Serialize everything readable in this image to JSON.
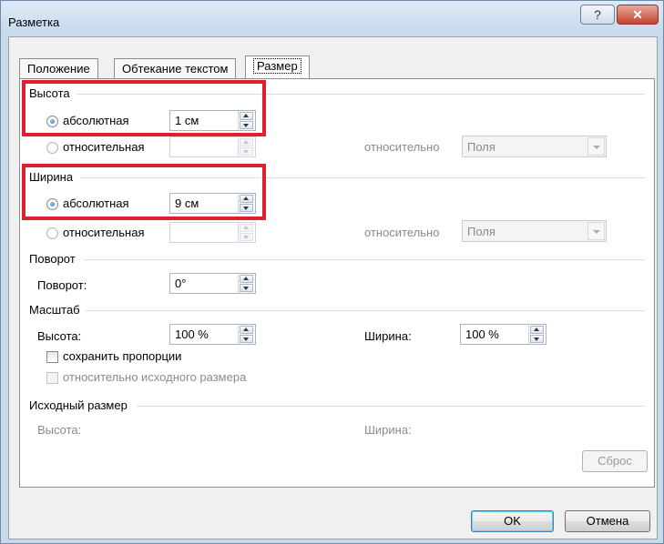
{
  "window": {
    "title": "Разметка",
    "help_label": "?",
    "close_label": "✕"
  },
  "tabs": [
    {
      "label": "Положение"
    },
    {
      "label": "Обтекание текстом"
    },
    {
      "label": "Размер"
    }
  ],
  "height_group": {
    "title": "Высота",
    "absolute_label": "абсолютная",
    "absolute_value": "1 см",
    "relative_label": "относительная",
    "relative_to_label": "относительно",
    "relative_to_value": "Поля"
  },
  "width_group": {
    "title": "Ширина",
    "absolute_label": "абсолютная",
    "absolute_value": "9 см",
    "relative_label": "относительная",
    "relative_to_label": "относительно",
    "relative_to_value": "Поля"
  },
  "rotation_group": {
    "title": "Поворот",
    "rotation_label": "Поворот:",
    "rotation_value": "0°"
  },
  "scale_group": {
    "title": "Масштаб",
    "height_label": "Высота:",
    "height_value": "100 %",
    "width_label": "Ширина:",
    "width_value": "100 %",
    "lock_aspect_label": "сохранить пропорции",
    "relative_original_label": "относительно исходного размера"
  },
  "original_group": {
    "title": "Исходный размер",
    "height_label": "Высота:",
    "width_label": "Ширина:"
  },
  "buttons": {
    "reset": "Сброс",
    "ok": "OK",
    "cancel": "Отмена"
  },
  "colors": {
    "highlight": "#e0202e",
    "window_frame": "#c8d9ec"
  }
}
